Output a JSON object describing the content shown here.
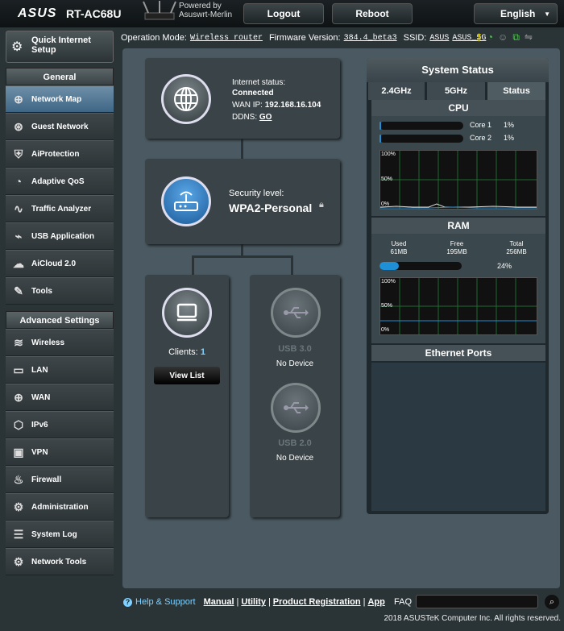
{
  "header": {
    "brand": "ASUS",
    "model": "RT-AC68U",
    "powered_by": "Powered by",
    "firmware_name": "Asuswrt-Merlin",
    "logout": "Logout",
    "reboot": "Reboot",
    "language": "English"
  },
  "info": {
    "op_label": "Operation Mode:",
    "op_value": "Wireless router",
    "fw_label": "Firmware Version:",
    "fw_value": "384.4_beta3",
    "ssid_label": "SSID:",
    "ssid1": "ASUS",
    "ssid2": "ASUS_5G"
  },
  "sidebar": {
    "qis": "Quick Internet Setup",
    "general_header": "General",
    "general": [
      {
        "label": "Network Map",
        "icon": "network-map-icon"
      },
      {
        "label": "Guest Network",
        "icon": "guest-network-icon"
      },
      {
        "label": "AiProtection",
        "icon": "aiprotection-icon"
      },
      {
        "label": "Adaptive QoS",
        "icon": "qos-icon"
      },
      {
        "label": "Traffic Analyzer",
        "icon": "traffic-analyzer-icon"
      },
      {
        "label": "USB Application",
        "icon": "usb-icon"
      },
      {
        "label": "AiCloud 2.0",
        "icon": "cloud-icon"
      },
      {
        "label": "Tools",
        "icon": "tools-icon"
      }
    ],
    "advanced_header": "Advanced Settings",
    "advanced": [
      {
        "label": "Wireless",
        "icon": "wireless-icon"
      },
      {
        "label": "LAN",
        "icon": "lan-icon"
      },
      {
        "label": "WAN",
        "icon": "wan-icon"
      },
      {
        "label": "IPv6",
        "icon": "ipv6-icon"
      },
      {
        "label": "VPN",
        "icon": "vpn-icon"
      },
      {
        "label": "Firewall",
        "icon": "firewall-icon"
      },
      {
        "label": "Administration",
        "icon": "administration-icon"
      },
      {
        "label": "System Log",
        "icon": "system-log-icon"
      },
      {
        "label": "Network Tools",
        "icon": "network-tools-icon"
      }
    ]
  },
  "internet": {
    "status_label": "Internet status:",
    "status_value": "Connected",
    "wan_label": "WAN IP:",
    "wan_ip": "192.168.16.104",
    "ddns_label": "DDNS:",
    "ddns_value": "GO"
  },
  "wireless": {
    "security_label": "Security level:",
    "security_value": "WPA2-Personal"
  },
  "clients": {
    "label": "Clients:",
    "count": "1",
    "view_list": "View List"
  },
  "usb": {
    "usb3": "USB 3.0",
    "usb3_status": "No Device",
    "usb2": "USB 2.0",
    "usb2_status": "No Device"
  },
  "system_status": {
    "title": "System Status",
    "tabs": [
      "2.4GHz",
      "5GHz",
      "Status"
    ],
    "cpu_title": "CPU",
    "core1_label": "Core 1",
    "core1_value": "1%",
    "core2_label": "Core 2",
    "core2_value": "1%",
    "core1_percent": 1,
    "core2_percent": 1,
    "graph_ticks": [
      "100%",
      "50%",
      "0%"
    ],
    "ram_title": "RAM",
    "used_label": "Used",
    "used_value": "61MB",
    "free_label": "Free",
    "free_value": "195MB",
    "total_label": "Total",
    "total_value": "256MB",
    "ram_percent_label": "24%",
    "ram_percent": 24,
    "ethernet_title": "Ethernet Ports"
  },
  "footer": {
    "help": "Help & Support",
    "manual": "Manual",
    "utility": "Utility",
    "product_reg": "Product Registration",
    "app": "App",
    "faq": "FAQ",
    "copyright": "2018 ASUSTeK Computer Inc. All rights reserved."
  },
  "colors": {
    "accent": "#1f8fd6",
    "link": "#7fd1ff"
  }
}
